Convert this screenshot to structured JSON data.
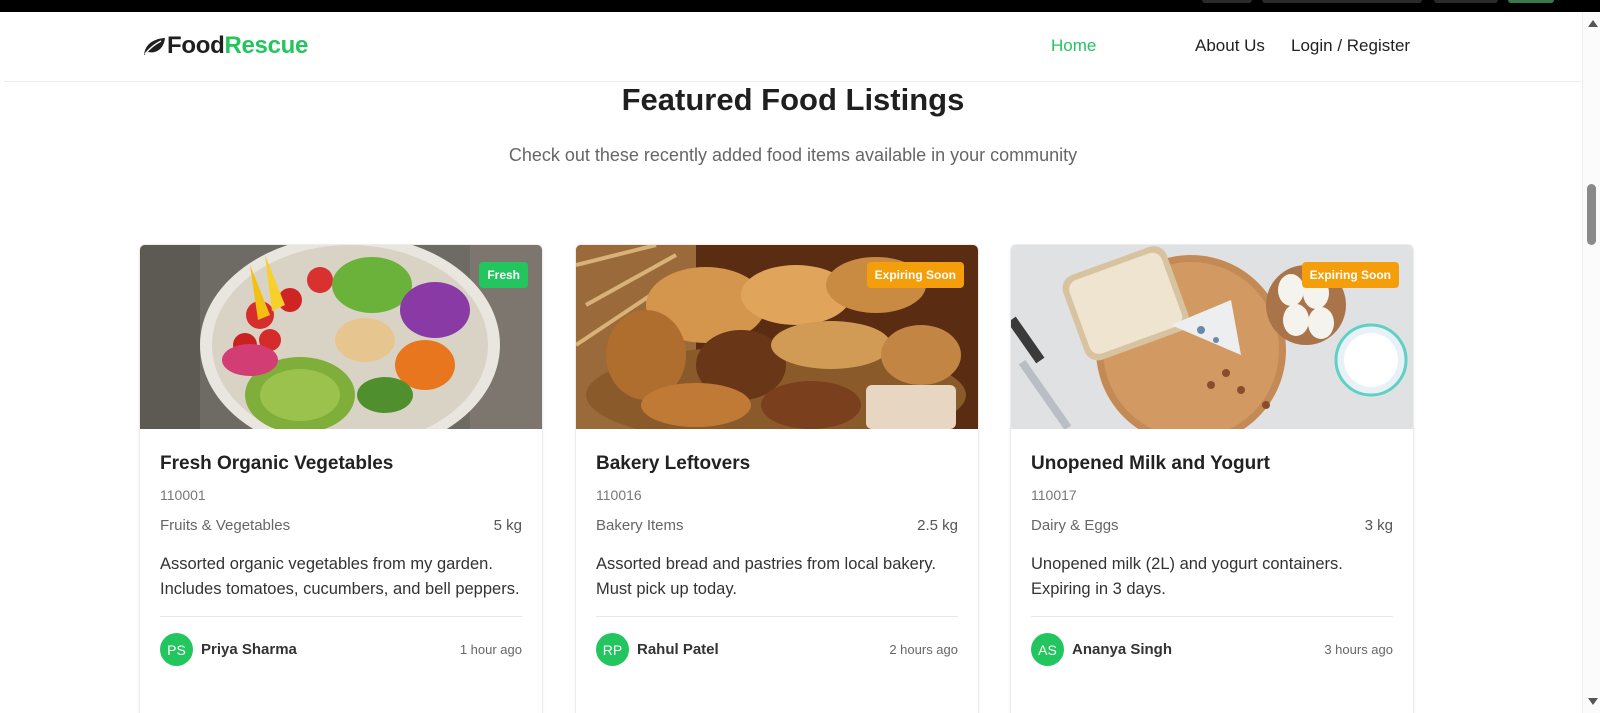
{
  "header": {
    "logo_food": "Food",
    "logo_rescue": "Rescue",
    "nav": {
      "home": "Home",
      "about": "About Us",
      "login": "Login / Register"
    }
  },
  "section": {
    "title": "Featured Food Listings",
    "subtitle": "Check out these recently added food items available in your community"
  },
  "listings": [
    {
      "badge": "Fresh",
      "title": "Fresh Organic Vegetables",
      "zip": "110001",
      "category": "Fruits & Vegetables",
      "quantity": "5 kg",
      "description": "Assorted organic vegetables from my garden. Includes tomatoes, cucumbers, and bell peppers.",
      "initials": "PS",
      "user": "Priya Sharma",
      "time": "1 hour ago"
    },
    {
      "badge": "Expiring Soon",
      "title": "Bakery Leftovers",
      "zip": "110016",
      "category": "Bakery Items",
      "quantity": "2.5 kg",
      "description": "Assorted bread and pastries from local bakery. Must pick up today.",
      "initials": "RP",
      "user": "Rahul Patel",
      "time": "2 hours ago"
    },
    {
      "badge": "Expiring Soon",
      "title": "Unopened Milk and Yogurt",
      "zip": "110017",
      "category": "Dairy & Eggs",
      "quantity": "3 kg",
      "description": "Unopened milk (2L) and yogurt containers. Expiring in 3 days.",
      "initials": "AS",
      "user": "Ananya Singh",
      "time": "3 hours ago"
    }
  ],
  "colors": {
    "accent": "#22c55e",
    "warning": "#f59e0b"
  },
  "icons": {
    "logo": "leaf-icon"
  }
}
